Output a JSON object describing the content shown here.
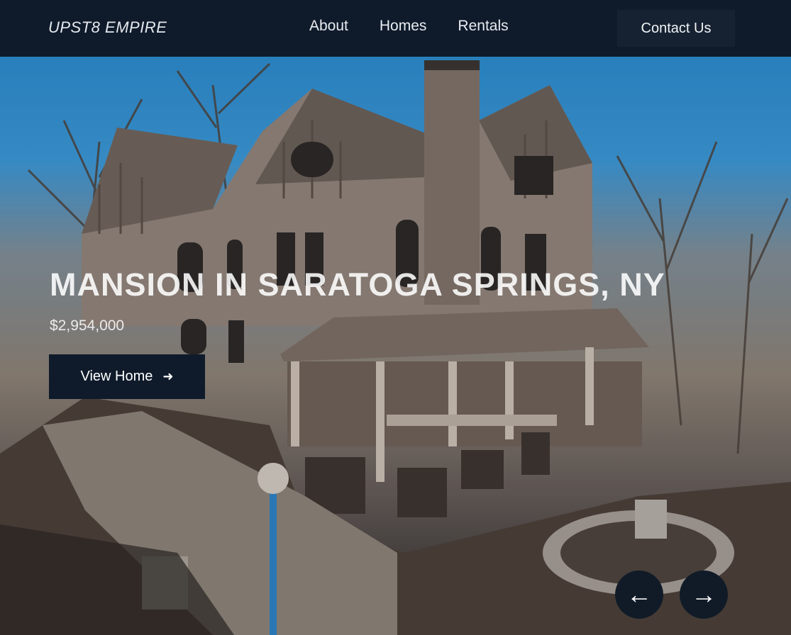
{
  "nav": {
    "brand": "UPST8 EMPIRE",
    "links": [
      {
        "label": "About"
      },
      {
        "label": "Homes"
      },
      {
        "label": "Rentals"
      }
    ],
    "contact_label": "Contact Us"
  },
  "hero": {
    "title": "MANSION IN SARATOGA SPRINGS, NY",
    "price": "$2,954,000",
    "button_label": "View Home",
    "button_icon": "arrow-right-icon",
    "image_icon": "mansion-photo",
    "prev_icon": "arrow-left-icon",
    "next_icon": "arrow-right-icon"
  },
  "colors": {
    "nav_bg": "#0f1b2b",
    "button_bg": "#0f1b2b",
    "sky": "#2b88c8"
  }
}
